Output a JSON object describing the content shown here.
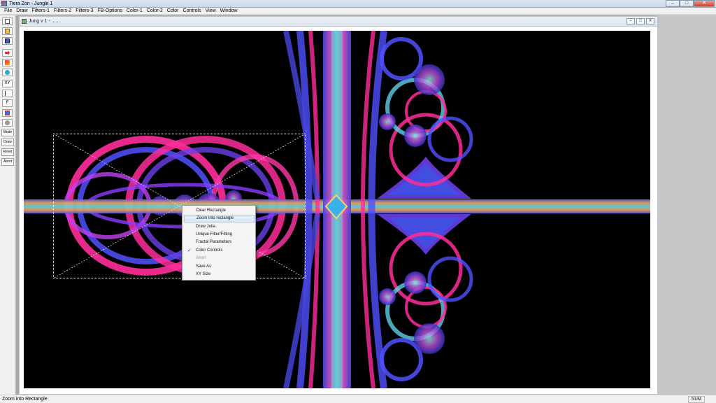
{
  "app": {
    "title": "Tiera Zon - Jungle 1"
  },
  "window_controls": {
    "minimize": "–",
    "maximize": "□",
    "close": "✕"
  },
  "menu": [
    "File",
    "Draw",
    "Filters-1",
    "Filters-2",
    "Filters-3",
    "FB-Options",
    "Color-1",
    "Color-2",
    "Color",
    "Controls",
    "View",
    "Window"
  ],
  "toolbar": {
    "buttons": [
      {
        "label": "",
        "icon": "new-file-icon"
      },
      {
        "label": "",
        "icon": "open-folder-icon"
      },
      {
        "label": "",
        "icon": "save-icon"
      },
      {
        "label": "",
        "icon": "arrow-red-icon"
      },
      {
        "label": "",
        "icon": "paint-icon"
      },
      {
        "label": "",
        "icon": "zoom-icon"
      },
      {
        "label": "XY",
        "icon": ""
      },
      {
        "label": "",
        "icon": "cursor-icon"
      },
      {
        "label": "F",
        "icon": ""
      },
      {
        "label": "",
        "icon": "grid-icon"
      },
      {
        "label": "",
        "icon": "circle-gray-icon"
      },
      {
        "label": "Mode",
        "icon": ""
      },
      {
        "label": "Draw",
        "icon": ""
      },
      {
        "label": "Reset",
        "icon": ""
      },
      {
        "label": "Abort",
        "icon": ""
      }
    ]
  },
  "child_window": {
    "title": "Jung v 1 - ......"
  },
  "context_menu": {
    "items": [
      {
        "label": "Clear Rectangle",
        "highlight": false,
        "disabled": false,
        "checked": false
      },
      {
        "label": "Zoom into rectangle",
        "highlight": true,
        "disabled": false,
        "checked": false
      },
      {
        "label": "Draw Julia",
        "highlight": false,
        "disabled": false,
        "checked": false
      },
      {
        "label": "Unique Filter/Fitting",
        "highlight": false,
        "disabled": false,
        "checked": false
      },
      {
        "label": "Fractal Parameters",
        "highlight": false,
        "disabled": false,
        "checked": false
      },
      {
        "label": "Color Controls",
        "highlight": false,
        "disabled": false,
        "checked": true
      },
      {
        "label": "Abort",
        "highlight": false,
        "disabled": true,
        "checked": false
      },
      {
        "label": "Save As",
        "highlight": false,
        "disabled": false,
        "checked": false
      },
      {
        "label": "XY Size",
        "highlight": false,
        "disabled": false,
        "checked": false
      }
    ],
    "check_mark": "✓"
  },
  "status": {
    "text": "Zoom into Rectangle",
    "num": "NUM"
  },
  "colors": {
    "canvas_bg": "#000000",
    "fractal_magenta": "#ff2d9a",
    "fractal_blue": "#5050ff",
    "fractal_cyan": "#52d7e6",
    "fractal_orange": "#e8a050"
  }
}
